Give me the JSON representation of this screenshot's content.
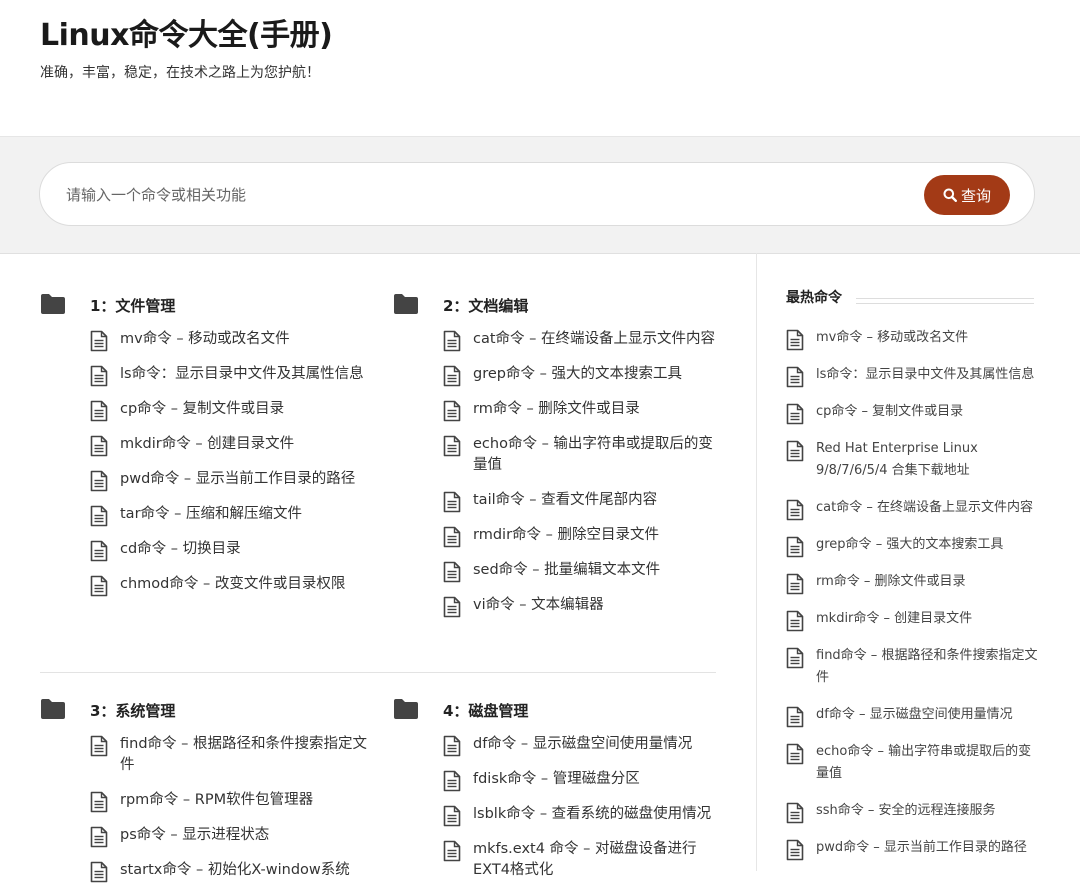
{
  "site": {
    "title": "Linux命令大全(手册)",
    "tagline": "准确，丰富，稳定，在技术之路上为您护航！"
  },
  "search": {
    "placeholder": "请输入一个命令或相关功能",
    "value": "",
    "button_label": "查询",
    "button_icon": "search-icon",
    "button_color": "#a33a16"
  },
  "sections": [
    {
      "title": "1：文件管理",
      "icon": "folder-icon",
      "items": [
        "mv命令 – 移动或改名文件",
        "ls命令：显示目录中文件及其属性信息",
        "cp命令 – 复制文件或目录",
        "mkdir命令 – 创建目录文件",
        "pwd命令 – 显示当前工作目录的路径",
        "tar命令 – 压缩和解压缩文件",
        "cd命令 – 切换目录",
        "chmod命令 – 改变文件或目录权限"
      ]
    },
    {
      "title": "2：文档编辑",
      "icon": "folder-icon",
      "items": [
        "cat命令 – 在终端设备上显示文件内容",
        "grep命令 – 强大的文本搜索工具",
        "rm命令 – 删除文件或目录",
        "echo命令 – 输出字符串或提取后的变量值",
        "tail命令 – 查看文件尾部内容",
        "rmdir命令 – 删除空目录文件",
        "sed命令 – 批量编辑文本文件",
        "vi命令 – 文本编辑器"
      ]
    },
    {
      "title": "3：系统管理",
      "icon": "folder-icon",
      "items": [
        "find命令 – 根据路径和条件搜索指定文件",
        "rpm命令 – RPM软件包管理器",
        "ps命令 – 显示进程状态",
        "startx命令 – 初始化X-window系统"
      ]
    },
    {
      "title": "4：磁盘管理",
      "icon": "folder-icon",
      "items": [
        "df命令 – 显示磁盘空间使用量情况",
        "fdisk命令 – 管理磁盘分区",
        "lsblk命令 – 查看系统的磁盘使用情况",
        "mkfs.ext4 命令 – 对磁盘设备进行EXT4格式化"
      ]
    }
  ],
  "sidebar": {
    "heading": "最热命令",
    "items": [
      "mv命令 – 移动或改名文件",
      "ls命令：显示目录中文件及其属性信息",
      "cp命令 – 复制文件或目录",
      "Red Hat Enterprise Linux 9/8/7/6/5/4 合集下载地址",
      "cat命令 – 在终端设备上显示文件内容",
      "grep命令 – 强大的文本搜索工具",
      "rm命令 – 删除文件或目录",
      "mkdir命令 – 创建目录文件",
      "find命令 – 根据路径和条件搜索指定文件",
      "df命令 – 显示磁盘空间使用量情况",
      "echo命令 – 输出字符串或提取后的变量值",
      "ssh命令 – 安全的远程连接服务",
      "pwd命令 – 显示当前工作目录的路径"
    ]
  }
}
